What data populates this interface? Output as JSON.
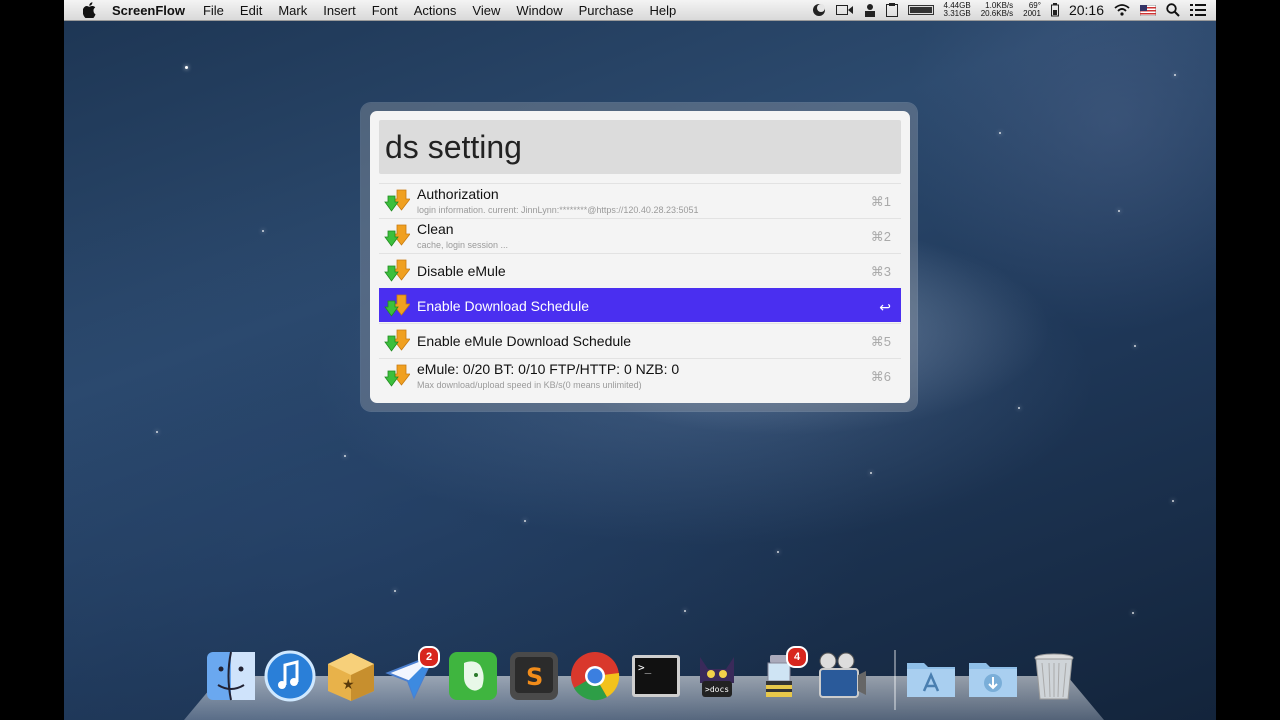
{
  "menubar": {
    "app_name": "ScreenFlow",
    "items": [
      "File",
      "Edit",
      "Mark",
      "Insert",
      "Font",
      "Actions",
      "View",
      "Window",
      "Purchase",
      "Help"
    ],
    "status": {
      "disk_top": "4.44GB",
      "disk_bottom": "3.31GB",
      "net_up": "1.0KB/s",
      "net_down": "20.6KB/s",
      "temp": "69°",
      "fan": "2001",
      "clock": "20:16"
    }
  },
  "launcher": {
    "query": "ds setting",
    "results": [
      {
        "title": "Authorization",
        "subtitle": "login information. current: JinnLynn:********@https://120.40.28.23:5051",
        "shortcut": "⌘1"
      },
      {
        "title": "Clean",
        "subtitle": "cache, login session ...",
        "shortcut": "⌘2"
      },
      {
        "title": "Disable eMule",
        "subtitle": "",
        "shortcut": "⌘3"
      },
      {
        "title": "Enable Download Schedule",
        "subtitle": "",
        "shortcut": "↩"
      },
      {
        "title": "Enable eMule Download Schedule",
        "subtitle": "",
        "shortcut": "⌘5"
      },
      {
        "title": "eMule: 0/20   BT: 0/10   FTP/HTTP: 0   NZB: 0",
        "subtitle": "Max download/upload speed in KB/s(0 means unlimited)",
        "shortcut": "⌘6"
      }
    ],
    "selected_index": 3
  },
  "dock": {
    "items": [
      {
        "icon": "finder-icon"
      },
      {
        "icon": "itunes-icon"
      },
      {
        "icon": "package-icon"
      },
      {
        "icon": "mail-plane-icon",
        "badge": "2"
      },
      {
        "icon": "evernote-icon"
      },
      {
        "icon": "sublime-text-icon"
      },
      {
        "icon": "chrome-icon"
      },
      {
        "icon": "terminal-icon"
      },
      {
        "icon": "docs-cat-icon"
      },
      {
        "icon": "lamp-icon",
        "badge": "4"
      },
      {
        "icon": "movie-icon"
      },
      {
        "icon": "applications-folder-icon"
      },
      {
        "icon": "downloads-folder-icon"
      },
      {
        "icon": "trash-icon"
      }
    ]
  },
  "colors": {
    "selection": "#4a2ff0",
    "menubar": "#e6e6e6"
  }
}
